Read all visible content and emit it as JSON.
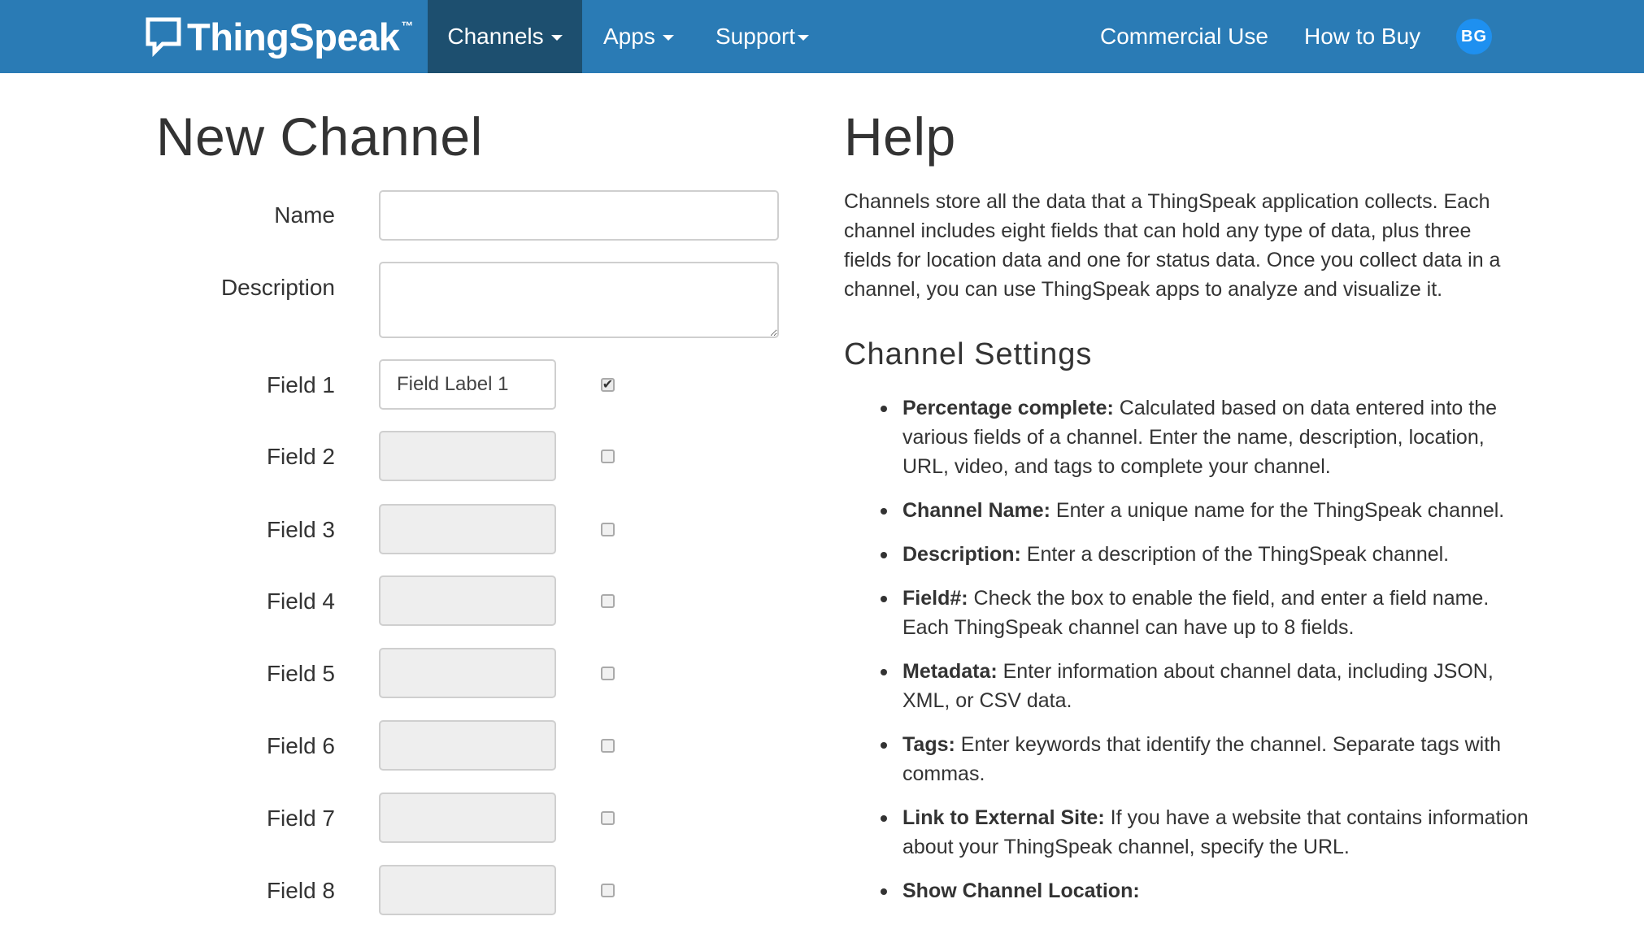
{
  "nav": {
    "brand": "ThingSpeak",
    "brand_tm": "™",
    "channels": "Channels",
    "apps": "Apps",
    "support": "Support",
    "commercial": "Commercial Use",
    "how_to_buy": "How to Buy",
    "avatar": "BG",
    "colors": {
      "bar": "#2a7bb5",
      "active": "#1d4f6f",
      "avatar": "#1e90f0"
    }
  },
  "form": {
    "title": "New Channel",
    "name_label": "Name",
    "name_value": "",
    "description_label": "Description",
    "description_value": "",
    "fields": [
      {
        "label": "Field 1",
        "value": "Field Label 1",
        "enabled": true
      },
      {
        "label": "Field 2",
        "value": "",
        "enabled": false
      },
      {
        "label": "Field 3",
        "value": "",
        "enabled": false
      },
      {
        "label": "Field 4",
        "value": "",
        "enabled": false
      },
      {
        "label": "Field 5",
        "value": "",
        "enabled": false
      },
      {
        "label": "Field 6",
        "value": "",
        "enabled": false
      },
      {
        "label": "Field 7",
        "value": "",
        "enabled": false
      },
      {
        "label": "Field 8",
        "value": "",
        "enabled": false
      }
    ]
  },
  "help": {
    "title": "Help",
    "intro": "Channels store all the data that a ThingSpeak application collects. Each channel includes eight fields that can hold any type of data, plus three fields for location data and one for status data. Once you collect data in a channel, you can use ThingSpeak apps to analyze and visualize it.",
    "settings_title": "Channel Settings",
    "items": [
      {
        "term": "Percentage complete:",
        "text": " Calculated based on data entered into the various fields of a channel. Enter the name, description, location, URL, video, and tags to complete your channel."
      },
      {
        "term": "Channel Name:",
        "text": " Enter a unique name for the ThingSpeak channel."
      },
      {
        "term": "Description:",
        "text": " Enter a description of the ThingSpeak channel."
      },
      {
        "term": "Field#:",
        "text": " Check the box to enable the field, and enter a field name. Each ThingSpeak channel can have up to 8 fields."
      },
      {
        "term": "Metadata:",
        "text": " Enter information about channel data, including JSON, XML, or CSV data."
      },
      {
        "term": "Tags:",
        "text": " Enter keywords that identify the channel. Separate tags with commas."
      },
      {
        "term": "Link to External Site:",
        "text": " If you have a website that contains information about your ThingSpeak channel, specify the URL."
      },
      {
        "term": "Show Channel Location:",
        "text": ""
      }
    ]
  }
}
